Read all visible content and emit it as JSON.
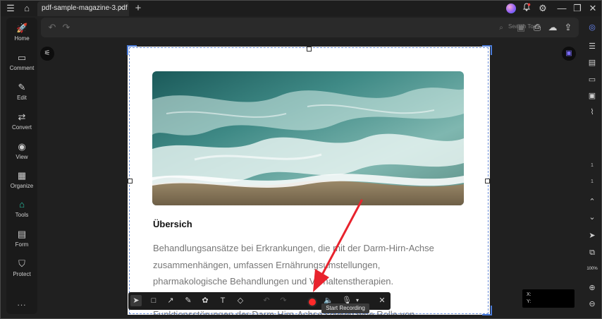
{
  "titlebar": {
    "tab_title": "pdf-sample-magazine-3.pdf",
    "tab_close": "✕",
    "new_tab": "+"
  },
  "toolbar": {
    "search_placeholder": "Search Tools"
  },
  "sidebar": {
    "items": [
      {
        "label": "Home",
        "icon": "rocket-icon"
      },
      {
        "label": "Comment",
        "icon": "comment-icon"
      },
      {
        "label": "Edit",
        "icon": "edit-icon"
      },
      {
        "label": "Convert",
        "icon": "convert-icon"
      },
      {
        "label": "View",
        "icon": "eye-icon"
      },
      {
        "label": "Organize",
        "icon": "organize-icon"
      },
      {
        "label": "Tools",
        "icon": "tools-icon",
        "active": true
      },
      {
        "label": "Form",
        "icon": "form-icon"
      },
      {
        "label": "Protect",
        "icon": "shield-icon"
      }
    ],
    "more": "..."
  },
  "document": {
    "heading": "Übersich",
    "lines": [
      "Behandlungsansätze bei Erkrankungen, die mit der Darm-Hirn-Achse",
      "zusammenhängen, umfassen Ernährungsumstellungen,",
      "pharmakologische Behandlungen und Verhaltenstherapien.",
      "",
      "Funktionsstörungen der Darm-Hirn-Achse spielen eine Rolle von"
    ]
  },
  "recording": {
    "tooltip": "Start Recording"
  },
  "rightbar": {
    "page_current": "1",
    "page_total": "1",
    "zoom": "100%"
  },
  "coords": {
    "x_label": "X:",
    "y_label": "Y:"
  },
  "colors": {
    "accent": "#29c5a6",
    "record": "#ff2a2a",
    "arrow": "#e8232d",
    "selection": "#4a7bd8"
  }
}
